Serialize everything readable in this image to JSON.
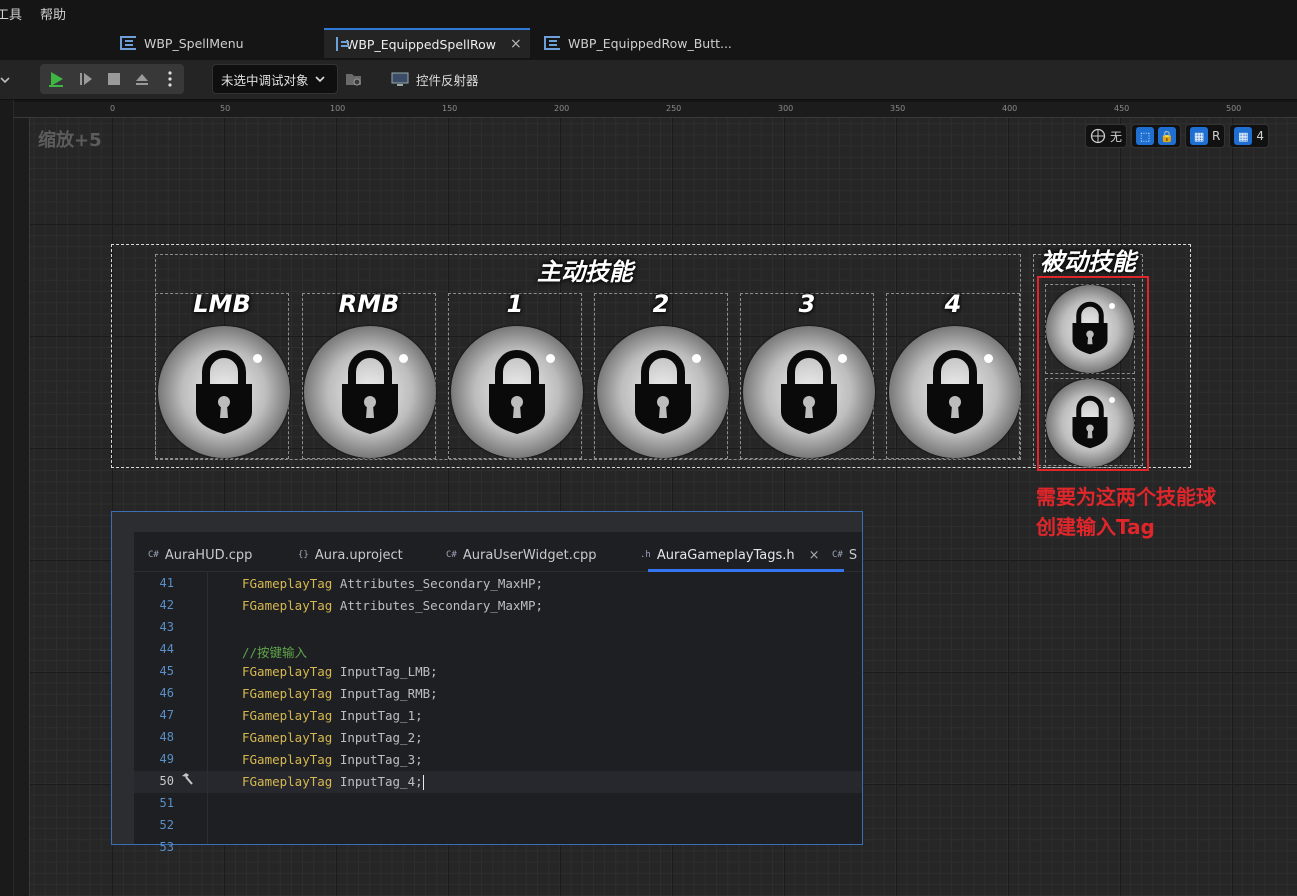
{
  "menubar": {
    "items": [
      "工具",
      "帮助"
    ]
  },
  "tabs": [
    {
      "label": "WBP_SpellMenu",
      "active": false
    },
    {
      "label": "WBP_EquippedSpellRow",
      "active": true,
      "close": "×"
    },
    {
      "label": "WBP_EquippedRow_Butt...",
      "active": false
    }
  ],
  "toolbar": {
    "debug_select": "未选中调试对象",
    "widget_reflector": "控件反射器"
  },
  "ruler": {
    "top_ticks": [
      "0",
      "50",
      "100",
      "150",
      "200",
      "250",
      "300",
      "350",
      "400",
      "450",
      "500"
    ]
  },
  "canvas": {
    "zoom_label": "缩放+5",
    "viewport_tools": {
      "none_label": "无",
      "r_label": "R",
      "grid_count": "4"
    }
  },
  "widget": {
    "active_title": "主动技能",
    "passive_title": "被动技能",
    "slots": [
      "LMB",
      "RMB",
      "1",
      "2",
      "3",
      "4"
    ]
  },
  "annotation": {
    "line1": "需要为这两个技能球",
    "line2": "创建输入Tag"
  },
  "code": {
    "tabs": [
      {
        "icon": "C#",
        "label": "AuraHUD.cpp"
      },
      {
        "icon": "{}",
        "label": "Aura.uproject"
      },
      {
        "icon": "C#",
        "label": "AuraUserWidget.cpp"
      },
      {
        "icon": ".h",
        "label": "AuraGameplayTags.h",
        "active": true,
        "close": "×"
      },
      {
        "icon": "C#",
        "label": "S"
      }
    ],
    "line_numbers": [
      "41",
      "42",
      "43",
      "44",
      "45",
      "46",
      "47",
      "48",
      "49",
      "50",
      "51",
      "52",
      "53"
    ],
    "lines": [
      {
        "type": "FGameplayTag",
        "name": "Attributes_Secondary_MaxHP;"
      },
      {
        "type": "FGameplayTag",
        "name": "Attributes_Secondary_MaxMP;"
      },
      {
        "type": "",
        "name": ""
      },
      {
        "comment": "//按键输入"
      },
      {
        "type": "FGameplayTag",
        "name": "InputTag_LMB;"
      },
      {
        "type": "FGameplayTag",
        "name": "InputTag_RMB;"
      },
      {
        "type": "FGameplayTag",
        "name": "InputTag_1;"
      },
      {
        "type": "FGameplayTag",
        "name": "InputTag_2;"
      },
      {
        "type": "FGameplayTag",
        "name": "InputTag_3;"
      },
      {
        "type": "FGameplayTag",
        "name": "InputTag_4;"
      }
    ]
  },
  "colors": {
    "accent": "#2f7ad8",
    "annotation_red": "#e0262b",
    "code_keyword": "#d6b850",
    "code_comment": "#5fa54a"
  }
}
